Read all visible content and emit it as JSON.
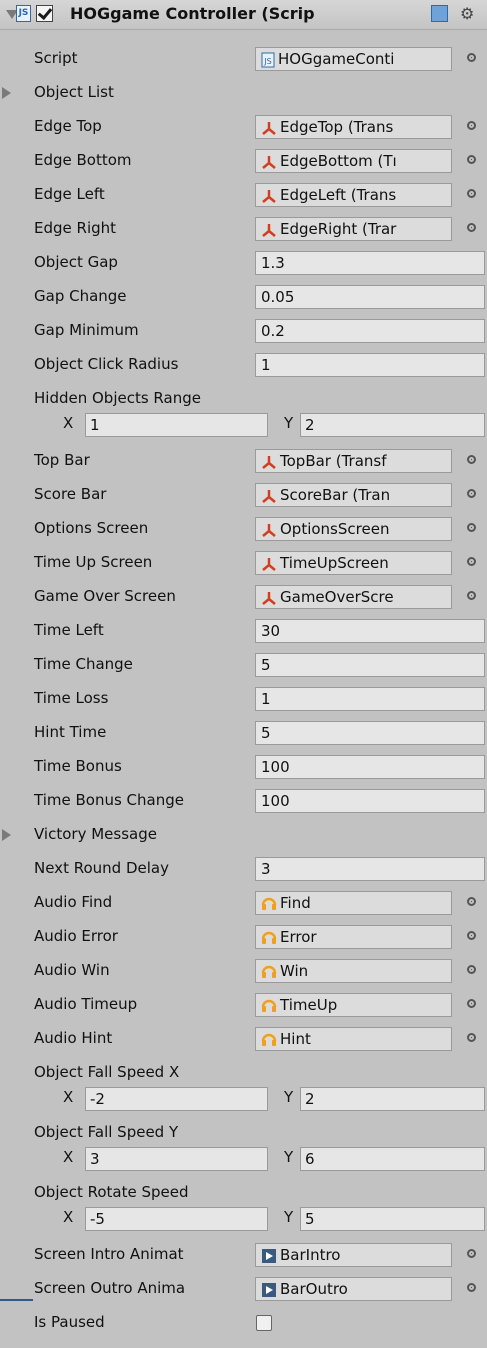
{
  "header": {
    "title": "HOGgame Controller (Scrip",
    "script_label": "JS",
    "gear": "⚙"
  },
  "fields": {
    "script": {
      "label": "Script",
      "value": "HOGgameConti"
    },
    "object_list": {
      "label": "Object List"
    },
    "edge_top": {
      "label": "Edge Top",
      "value": "EdgeTop (Trans"
    },
    "edge_bottom": {
      "label": "Edge Bottom",
      "value": "EdgeBottom (Tı"
    },
    "edge_left": {
      "label": "Edge Left",
      "value": "EdgeLeft (Trans"
    },
    "edge_right": {
      "label": "Edge Right",
      "value": "EdgeRight (Trar"
    },
    "object_gap": {
      "label": "Object Gap",
      "value": "1.3"
    },
    "gap_change": {
      "label": "Gap Change",
      "value": "0.05"
    },
    "gap_minimum": {
      "label": "Gap Minimum",
      "value": "0.2"
    },
    "object_click_radius": {
      "label": "Object Click Radius",
      "value": "1"
    },
    "hidden_objects_range": {
      "label": "Hidden Objects Range",
      "x": "1",
      "y": "2"
    },
    "top_bar": {
      "label": "Top Bar",
      "value": "TopBar (Transf"
    },
    "score_bar": {
      "label": "Score Bar",
      "value": "ScoreBar (Tran"
    },
    "options_screen": {
      "label": "Options Screen",
      "value": "OptionsScreen"
    },
    "time_up_screen": {
      "label": "Time Up Screen",
      "value": "TimeUpScreen"
    },
    "game_over_screen": {
      "label": "Game Over Screen",
      "value": "GameOverScre"
    },
    "time_left": {
      "label": "Time Left",
      "value": "30"
    },
    "time_change": {
      "label": "Time Change",
      "value": "5"
    },
    "time_loss": {
      "label": "Time Loss",
      "value": "1"
    },
    "hint_time": {
      "label": "Hint Time",
      "value": "5"
    },
    "time_bonus": {
      "label": "Time Bonus",
      "value": "100"
    },
    "time_bonus_change": {
      "label": "Time Bonus Change",
      "value": "100"
    },
    "victory_message": {
      "label": "Victory Message"
    },
    "next_round_delay": {
      "label": "Next Round Delay",
      "value": "3"
    },
    "audio_find": {
      "label": "Audio Find",
      "value": "Find"
    },
    "audio_error": {
      "label": "Audio Error",
      "value": "Error"
    },
    "audio_win": {
      "label": "Audio Win",
      "value": "Win"
    },
    "audio_timeup": {
      "label": "Audio Timeup",
      "value": "TimeUp"
    },
    "audio_hint": {
      "label": "Audio Hint",
      "value": "Hint"
    },
    "object_fall_speed_x": {
      "label": "Object Fall Speed X",
      "x": "-2",
      "y": "2"
    },
    "object_fall_speed_y": {
      "label": "Object Fall Speed Y",
      "x": "3",
      "y": "6"
    },
    "object_rotate_speed": {
      "label": "Object Rotate Speed",
      "x": "-5",
      "y": "5"
    },
    "screen_intro_animation": {
      "label": "Screen Intro Animat",
      "value": "BarIntro"
    },
    "screen_outro_animation": {
      "label": "Screen Outro Anima",
      "value": "BarOutro"
    },
    "is_paused": {
      "label": "Is Paused"
    }
  },
  "vector_labels": {
    "x": "X",
    "y": "Y"
  },
  "colors": {
    "background": "#c2c2c2",
    "accent": "#2e6aa8",
    "audio": "#f0a020",
    "transform": "#d04020"
  }
}
